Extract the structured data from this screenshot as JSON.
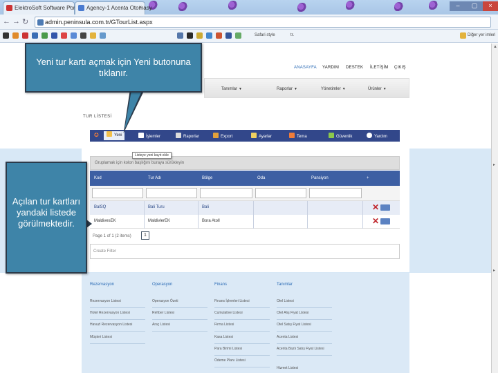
{
  "browser": {
    "tabs": [
      {
        "label": "ElektroSoft Software Porta",
        "close": "×"
      },
      {
        "label": "Agency-1 Acenta Otomasy",
        "close": "×"
      }
    ],
    "window_controls": [
      "–",
      "▢",
      "×"
    ],
    "url": "admin.peninsula.com.tr/GTourList.aspx",
    "bookmarks_right": [
      "Safari style",
      "tr.",
      "Diğer yer imleri"
    ]
  },
  "site_nav": [
    "ANASAYFA",
    "YARDIM",
    "DESTEK",
    "İLETİŞİM",
    "ÇIKIŞ"
  ],
  "menu": [
    "Tanımlar",
    "Raporlar",
    "Yönetimler",
    "Ürünler"
  ],
  "page_title": "TUR LİSTESİ",
  "toolbar": [
    {
      "label": "Yeni",
      "icon": "new-icon",
      "color": "#f3c04a"
    },
    {
      "label": "İşlemler",
      "icon": "actions-icon",
      "color": "#ffffff"
    },
    {
      "label": "Raporlar",
      "icon": "report-icon",
      "color": "#dddddd"
    },
    {
      "label": "Export",
      "icon": "export-icon",
      "color": "#e2a13a"
    },
    {
      "label": "Ayarlar",
      "icon": "settings-icon",
      "color": "#f0d060"
    },
    {
      "label": "Tema",
      "icon": "theme-icon",
      "color": "#f07c3a"
    },
    {
      "label": "Güvenlik",
      "icon": "security-icon",
      "color": "#8cc84b"
    },
    {
      "label": "Yardım",
      "icon": "help-icon",
      "color": "#ffffff"
    }
  ],
  "tooltip": "Listeye yeni kayıt ekle",
  "group_hint": "Gruplamak için kolon başlığını buraya sürükleyin",
  "grid": {
    "columns": [
      "Kod",
      "Tur Adı",
      "Bölge",
      "Oda",
      "Pansiyon",
      "+"
    ],
    "rows": [
      {
        "kod": "BalSQ",
        "tur_adi": "Bali Turu",
        "bolge": "Bali",
        "oda": "",
        "pansiyon": ""
      },
      {
        "kod": "MaldivesEK",
        "tur_adi": "MaldivlerEK",
        "bolge": "Bora Atoll",
        "oda": "",
        "pansiyon": ""
      }
    ],
    "pager_text": "Page 1 of 1 (2 items)",
    "pager_page": "1",
    "create_filter": "Create Filter"
  },
  "footer": {
    "columns": [
      {
        "title": "Rezervasyon",
        "links": [
          "Rezervasyon Listesi",
          "Hotel Rezervasyon Listesi",
          "Havuzl Rezervasyon Listesi",
          "Müşteri Listesi"
        ]
      },
      {
        "title": "Operasyon",
        "links": [
          "Operasyon Özeti",
          "Rehber Listesi",
          "Araç Listesi"
        ]
      },
      {
        "title": "Finans",
        "links": [
          "Finans İşlemleri Listesi",
          "Cumulative Listesi",
          "Firma Listesi",
          "Kasa Listesi",
          "Para Birimi Listesi",
          "Ödeme Planı Listesi"
        ]
      },
      {
        "title": "Tanımlar",
        "links": [
          "Otel Listesi",
          "Otel Alış Fiyat Listesi",
          "Otel Satış Fiyat Listesi",
          "Acenta Listesi",
          "Acenta Bazlı Satış Fiyat Listesi",
          "Hizmet Listesi"
        ]
      }
    ]
  },
  "callouts": {
    "first": "Yeni tur kartı açmak için Yeni butonuna tıklanır.",
    "second": "Açılan tur kartları yandaki listede görülmektedir."
  }
}
